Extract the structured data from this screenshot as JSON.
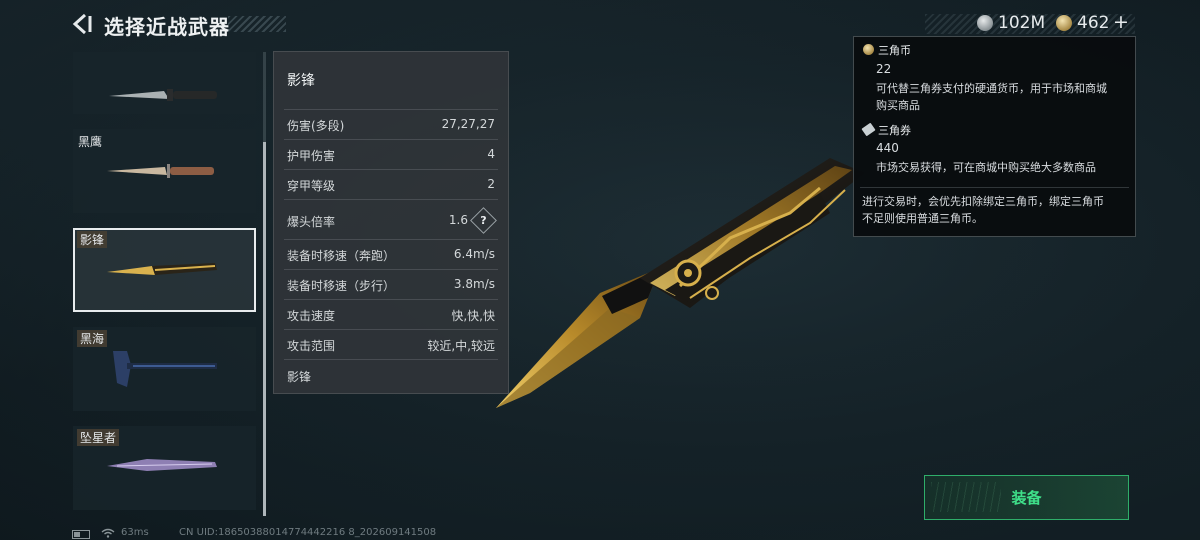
{
  "header": {
    "title": "选择近战武器"
  },
  "currency": {
    "silver_amount": "102M",
    "gold_amount": "462",
    "plus": "+"
  },
  "weapons": [
    {
      "label": "",
      "icon": "combat-knife-icon"
    },
    {
      "label": "黑鹰",
      "icon": "hunting-knife-icon"
    },
    {
      "label": "影锋",
      "icon": "gold-blade-icon",
      "selected": true
    },
    {
      "label": "黑海",
      "icon": "tactical-axe-icon"
    },
    {
      "label": "坠星者",
      "icon": "purple-blade-icon"
    }
  ],
  "stats": {
    "title": "影锋",
    "rows": [
      {
        "key": "伤害(多段)",
        "value": "27,27,27"
      },
      {
        "key": "护甲伤害",
        "value": "4"
      },
      {
        "key": "穿甲等级",
        "value": "2"
      },
      {
        "key": "爆头倍率",
        "value": "1.6",
        "help": "?"
      },
      {
        "key": "装备时移速（奔跑）",
        "value": "6.4m/s"
      },
      {
        "key": "装备时移速（步行）",
        "value": "3.8m/s"
      },
      {
        "key": "攻击速度",
        "value": "快,快,快"
      },
      {
        "key": "攻击范围",
        "value": "较近,中,较远"
      }
    ],
    "footer_name": "影锋"
  },
  "tooltip": {
    "coin_name": "三角币",
    "coin_amount": "22",
    "coin_desc_1": "可代替三角券支付的硬通货币，用于市场和商城",
    "coin_desc_2": "购买商品",
    "ticket_name": "三角券",
    "ticket_amount": "440",
    "ticket_desc": "市场交易获得，可在商城中购买绝大多数商品",
    "note_1": "进行交易时，会优先扣除绑定三角币，绑定三角币",
    "note_2": "不足则使用普通三角币。"
  },
  "equip_button": "装备",
  "status": {
    "ping": "63ms",
    "uid": "CN UID:18650388014774442216 8_202609141508"
  },
  "colors": {
    "accent_green": "#3fe08a",
    "gold": "#c9a43e"
  }
}
